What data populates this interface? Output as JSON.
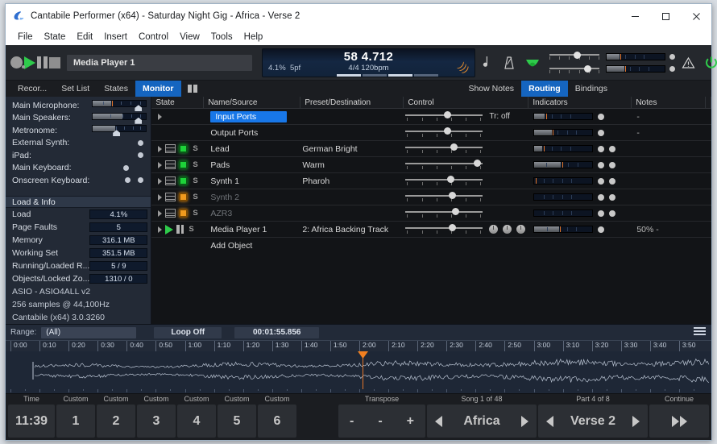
{
  "window": {
    "title": "Cantabile Performer (x64) - Saturday Night Gig - Africa - Verse 2",
    "minimize": "─",
    "maximize": "□",
    "close": "✕"
  },
  "menu": [
    "File",
    "State",
    "Edit",
    "Insert",
    "Control",
    "View",
    "Tools",
    "Help"
  ],
  "toolbar": {
    "record_icon": "record-icon",
    "play_icon": "play-icon",
    "pause_icon": "pause-icon",
    "stop_icon": "stop-icon",
    "media_player_field": "Media Player 1",
    "transport": {
      "position": "58 4.712",
      "load": "4.1%",
      "spf": "5pf",
      "time_sig_tempo": "4/4 120bpm"
    },
    "note_icon": "note-icon",
    "metronome_icon": "metronome-icon",
    "tuner_icon": "tuner-icon",
    "warning_icon": "warning-icon",
    "power_icon": "power-icon"
  },
  "tabs": {
    "left": [
      {
        "label": "Recor...",
        "active": false
      },
      {
        "label": "Set List",
        "active": false
      },
      {
        "label": "States",
        "active": false
      },
      {
        "label": "Monitor",
        "active": true
      }
    ],
    "right": [
      {
        "label": "Show Notes",
        "active": false
      },
      {
        "label": "Routing",
        "active": true
      },
      {
        "label": "Bindings",
        "active": false
      }
    ]
  },
  "sidebar": {
    "items": [
      {
        "label": "Main Microphone:",
        "type": "meter",
        "fill": 34,
        "peak": 46,
        "thumb": 80
      },
      {
        "label": "Main Speakers:",
        "type": "meter",
        "fill": 55,
        "peak": 0,
        "thumb": 80
      },
      {
        "label": "Metronome:",
        "type": "meter",
        "fill": 40,
        "peak": 0,
        "thumb": 40
      },
      {
        "label": "External Synth:",
        "type": "dots",
        "dots": 1
      },
      {
        "label": "iPad:",
        "type": "dots",
        "dots": 1
      },
      {
        "label": "Main Keyboard:",
        "type": "dots-left",
        "dots": 1
      },
      {
        "label": "Onscreen Keyboard:",
        "type": "dots2",
        "dots": 2
      }
    ]
  },
  "load_info": {
    "title": "Load & Info",
    "rows": [
      {
        "key": "Load",
        "value": "4.1%"
      },
      {
        "key": "Page Faults",
        "value": "5"
      },
      {
        "key": "Memory",
        "value": "316.1 MB"
      },
      {
        "key": "Working Set",
        "value": "351.5 MB"
      },
      {
        "key": "Running/Loaded R...",
        "value": "5 / 9"
      },
      {
        "key": "Objects/Locked Zo...",
        "value": "1310 / 0"
      }
    ],
    "notes": [
      "ASIO - ASIO4ALL v2",
      "256 samples @ 44,100Hz",
      "Cantabile (x64) 3.0.3260"
    ]
  },
  "routing": {
    "headers": [
      "State",
      "Name/Source",
      "Preset/Destination",
      "Control",
      "Indicators",
      "Notes"
    ],
    "rows": [
      {
        "name": "Input Ports",
        "preset": "",
        "notes": "-",
        "selected": true,
        "state": "arrow",
        "control_extra": "Tr: off",
        "slider": 50,
        "meter_fill": 18,
        "meter_peak": 20,
        "dots": 1,
        "dim": false
      },
      {
        "name": "Output Ports",
        "preset": "",
        "notes": "-",
        "selected": false,
        "state": "none",
        "slider": 50,
        "meter_fill": 30,
        "meter_peak": 32,
        "dots": 1,
        "dim": false
      },
      {
        "name": "Lead",
        "preset": "German Bright",
        "notes": "",
        "selected": false,
        "state": "kbd",
        "led": "green",
        "slider": 58,
        "meter_fill": 14,
        "meter_peak": 16,
        "dots": 2,
        "dim": false
      },
      {
        "name": "Pads",
        "preset": "Warm",
        "notes": "",
        "selected": false,
        "state": "kbd",
        "led": "green",
        "slider": 88,
        "meter_fill": 46,
        "meter_peak": 48,
        "dots": 2,
        "dim": false
      },
      {
        "name": "Synth 1",
        "preset": "Pharoh",
        "notes": "",
        "selected": false,
        "state": "kbd",
        "led": "green",
        "slider": 54,
        "meter_fill": 1,
        "meter_peak": 2,
        "dots": 2,
        "dim": false
      },
      {
        "name": "Synth 2",
        "preset": "",
        "notes": "",
        "selected": false,
        "state": "kbd",
        "led": "orange",
        "slider": 56,
        "meter_fill": 0,
        "meter_peak": 0,
        "dots": 2,
        "dim": true
      },
      {
        "name": "AZR3",
        "preset": "",
        "notes": "",
        "selected": false,
        "state": "kbd-slim",
        "led": "orange",
        "slider": 60,
        "meter_fill": 0,
        "meter_peak": 0,
        "dots": 2,
        "dim": true
      },
      {
        "name": "Media Player 1",
        "preset": "2: Africa Backing Track",
        "notes": "50%  -",
        "selected": false,
        "state": "player",
        "slider": 56,
        "meter_fill": 42,
        "meter_peak": 44,
        "dots": 1,
        "knobs": 3,
        "dim": false
      }
    ],
    "add_object": "Add Object"
  },
  "timeline": {
    "range_label": "Range:",
    "range_value": "(All)",
    "loop": "Loop Off",
    "length": "00:01:55.856",
    "menu_icon": "hamburger-icon",
    "ticks": [
      "0:00",
      "0:10",
      "0:20",
      "0:30",
      "0:40",
      "0:50",
      "1:00",
      "1:10",
      "1:20",
      "1:30",
      "1:40",
      "1:50",
      "2:00",
      "2:10",
      "2:20",
      "2:30",
      "2:40",
      "2:50",
      "3:00",
      "3:10",
      "3:20",
      "3:30",
      "3:40",
      "3:50"
    ],
    "playhead_ratio": 0.505
  },
  "bottom_buttons": [
    {
      "caption": "Time",
      "label": "11:39",
      "kind": "text"
    },
    {
      "caption": "Custom",
      "label": "1",
      "kind": "text"
    },
    {
      "caption": "Custom",
      "label": "2",
      "kind": "text"
    },
    {
      "caption": "Custom",
      "label": "3",
      "kind": "text"
    },
    {
      "caption": "Custom",
      "label": "4",
      "kind": "text"
    },
    {
      "caption": "Custom",
      "label": "5",
      "kind": "text"
    },
    {
      "caption": "Custom",
      "label": "6",
      "kind": "text"
    }
  ],
  "bottom_right": {
    "transpose": {
      "caption": "Transpose",
      "minus1": "-",
      "minus2": "-",
      "plus": "+"
    },
    "song": {
      "caption": "Song 1 of 48",
      "value": "Africa"
    },
    "part": {
      "caption": "Part 4 of 8",
      "value": "Verse 2"
    },
    "continue": {
      "caption": "Continue",
      "icon": "fast-forward-icon"
    }
  },
  "colors": {
    "accent_blue": "#1565c0",
    "selection_blue": "#1877e8",
    "green_led": "#1ed33a",
    "orange_led": "#f09a1e",
    "playhead_orange": "#e2752a",
    "panel_navy": "#222a38"
  }
}
